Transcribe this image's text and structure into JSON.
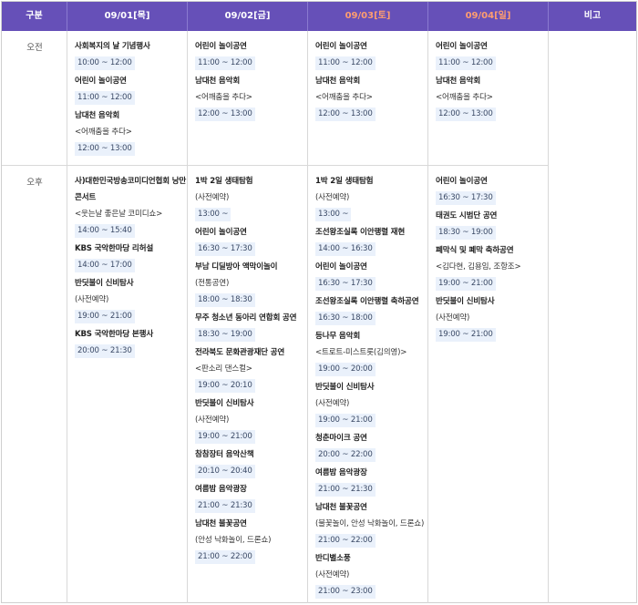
{
  "header": {
    "col_label": "구분",
    "days": [
      "09/01[목]",
      "09/02[금]",
      "09/03[토]",
      "09/04[일]"
    ],
    "note": "비고"
  },
  "rows": {
    "am_label": "오전",
    "pm_label": "오후"
  },
  "am": [
    [
      {
        "title": "사회복지의 날 기념행사",
        "sub": "",
        "time": "10:00 ~ 12:00"
      },
      {
        "title": "어린이 놀이공연",
        "sub": "",
        "time": "11:00 ~ 12:00"
      },
      {
        "title": "남대천 음악회",
        "sub": "<어깨춤을 추다>",
        "time": "12:00 ~ 13:00"
      }
    ],
    [
      {
        "title": "어린이 놀이공연",
        "sub": "",
        "time": "11:00 ~ 12:00"
      },
      {
        "title": "남대천 음악회",
        "sub": "<어깨춤을 추다>",
        "time": "12:00 ~ 13:00"
      }
    ],
    [
      {
        "title": "어린이 놀이공연",
        "sub": "",
        "time": "11:00 ~ 12:00"
      },
      {
        "title": "남대천 음악회",
        "sub": "<어깨춤을 추다>",
        "time": "12:00 ~ 13:00"
      }
    ],
    [
      {
        "title": "어린이 놀이공연",
        "sub": "",
        "time": "11:00 ~ 12:00"
      },
      {
        "title": "남대천 음악회",
        "sub": "<어깨춤을 추다>",
        "time": "12:00 ~ 13:00"
      }
    ]
  ],
  "pm": [
    [
      {
        "title": "사)대한민국방송코미디언협회 낭만 콘서트",
        "sub": "<웃는날 좋은날 코미디쇼>",
        "time": "14:00 ~ 15:40"
      },
      {
        "title": "KBS 국악한마당 리허설",
        "sub": "",
        "time": "14:00 ~ 17:00"
      },
      {
        "title": "반딧불이 신비탐사",
        "sub": "(사전예약)",
        "time": "19:00 ~ 21:00"
      },
      {
        "title": "KBS 국악한마당 본행사",
        "sub": "",
        "time": "20:00 ~ 21:30"
      }
    ],
    [
      {
        "title": "1박 2일 생태탐험",
        "sub": "(사전예약)",
        "time": "13:00 ~"
      },
      {
        "title": "어린이 놀이공연",
        "sub": "",
        "time": "16:30 ~ 17:30"
      },
      {
        "title": "부남 디딜방아 액막이놀이",
        "sub": "(전통공연)",
        "time": "18:00 ~ 18:30"
      },
      {
        "title": "무주 청소년 동아리 연합회 공연",
        "sub": "",
        "time": "18:30 ~ 19:00"
      },
      {
        "title": "전라북도 문화관광재단 공연",
        "sub": "<판소리 댄스컬>",
        "time": "19:00 ~ 20:10"
      },
      {
        "title": "반딧불이 신비탐사",
        "sub": "(사전예약)",
        "time": "19:00 ~ 21:00"
      },
      {
        "title": "참참장터 음악산책",
        "sub": "",
        "time": "20:10 ~ 20:40"
      },
      {
        "title": "여름밤 음악광장",
        "sub": "",
        "time": "21:00 ~ 21:30"
      },
      {
        "title": "남대천 불꽃공연",
        "sub": "(안성 낙화놀이, 드론쇼)",
        "time": "21:00 ~ 22:00"
      }
    ],
    [
      {
        "title": "1박 2일 생태탐험",
        "sub": "(사전예약)",
        "time": "13:00 ~"
      },
      {
        "title": "조선왕조실록 이안행렬 재현",
        "sub": "",
        "time": "14:00 ~ 16:30"
      },
      {
        "title": "어린이 놀이공연",
        "sub": "",
        "time": "16:30 ~ 17:30"
      },
      {
        "title": "조선왕조실록 이안행렬 축하공연",
        "sub": "",
        "time": "16:30 ~ 18:00"
      },
      {
        "title": "등나무 음악회",
        "sub": "<트로트-미스트롯(김의영)>",
        "time": "19:00 ~ 20:00"
      },
      {
        "title": "반딧불이 신비탐사",
        "sub": "(사전예약)",
        "time": "19:00 ~ 21:00"
      },
      {
        "title": "청춘마이크 공연",
        "sub": "",
        "time": "20:00 ~ 22:00"
      },
      {
        "title": "여름밤 음악광장",
        "sub": "",
        "time": "21:00 ~ 21:30"
      },
      {
        "title": "남대천 불꽃공연",
        "sub": "(불꽃놀이, 안성 낙화놀이, 드론쇼)",
        "time": "21:00 ~ 22:00"
      },
      {
        "title": "반디별소풍",
        "sub": "(사전예약)",
        "time": "21:00 ~ 23:00"
      }
    ],
    [
      {
        "title": "어린이 놀이공연",
        "sub": "",
        "time": "16:30 ~ 17:30"
      },
      {
        "title": "태권도 시범단 공연",
        "sub": "",
        "time": "18:30 ~ 19:00"
      },
      {
        "title": "폐막식 및 폐막 축하공연",
        "sub": "<김다현, 김용임, 조항조>",
        "time": "19:00 ~ 21:00"
      },
      {
        "title": "반딧불이 신비탐사",
        "sub": "(사전예약)",
        "time": "19:00 ~ 21:00"
      }
    ]
  ]
}
